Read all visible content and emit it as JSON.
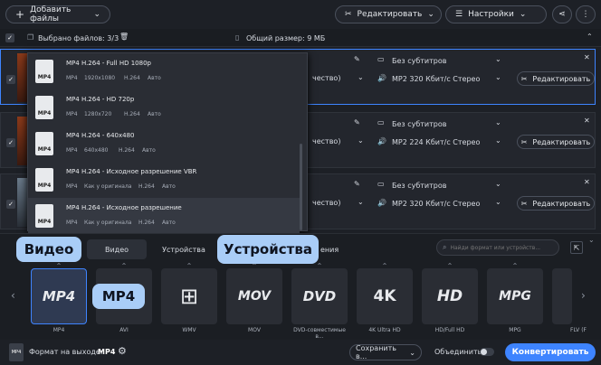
{
  "toolbar": {
    "add_files": "Добавить файлы",
    "edit": "Редактировать",
    "settings": "Настройки"
  },
  "filesbar": {
    "selected": "Выбрано файлов: 3/3",
    "total_size": "Общий размер: 9 МБ"
  },
  "rows": [
    {
      "subtitle": "Без субтитров",
      "audio": "MP2 320 Кбит/с Стерео",
      "quality_tail": "чество)",
      "edit": "Редактировать"
    },
    {
      "subtitle": "Без субтитров",
      "audio": "MP2 224 Кбит/с Стерео",
      "quality_tail": "чество)",
      "edit": "Редактировать"
    },
    {
      "subtitle": "Без субтитров",
      "audio": "MP2 320 Кбит/с Стерео",
      "quality_tail": "чество)",
      "edit": "Редактировать"
    }
  ],
  "dropdown": {
    "items": [
      {
        "title": "MP4 H.264 - Full HD 1080p",
        "specs": [
          "MP4",
          "1920x1080",
          "H.264",
          "Авто"
        ],
        "icon": "MP4"
      },
      {
        "title": "MP4 H.264 - HD 720p",
        "specs": [
          "MP4",
          "1280x720",
          "H.264",
          "Авто"
        ],
        "icon": "MP4"
      },
      {
        "title": "MP4 H.264 - 640x480",
        "specs": [
          "MP4",
          "640x480",
          "H.264",
          "Авто"
        ],
        "icon": "MP4"
      },
      {
        "title": "MP4 H.264 - Исходное разрешение VBR",
        "specs": [
          "MP4",
          "Как у оригинала",
          "H.264",
          "Авто"
        ],
        "icon": "MP4"
      },
      {
        "title": "MP4 H.264 - Исходное разрешение",
        "specs": [
          "MP4",
          "Как у оригинала",
          "H.264",
          "Авто"
        ],
        "icon": "MP4"
      }
    ]
  },
  "tabs": {
    "video": "Видео",
    "devices": "Устройства",
    "partial": "ения"
  },
  "search_placeholder": "Найди формат или устройств...",
  "callouts": {
    "video": "Видео",
    "devices": "Устройства",
    "mp4": "MP4"
  },
  "formats": [
    {
      "icon": "MP4",
      "label": "MP4"
    },
    {
      "icon": "",
      "label": "AVI"
    },
    {
      "icon": "WIN",
      "label": "WMV"
    },
    {
      "icon": "MOV",
      "label": "MOV"
    },
    {
      "icon": "DVD",
      "label": "DVD-совместимые в..."
    },
    {
      "icon": "4K",
      "label": "4K Ultra HD"
    },
    {
      "icon": "HD",
      "label": "HD/Full HD"
    },
    {
      "icon": "MPG",
      "label": "MPG"
    },
    {
      "icon": "",
      "label": "FLV (F"
    }
  ],
  "bottom": {
    "output_label": "Формат на выходе:",
    "output_value": "MP4",
    "save_to": "Сохранить в...",
    "merge": "Объединить:",
    "convert": "Конвертировать"
  },
  "colors": {
    "accent": "#3e84ff",
    "callout": "#a9cdf7"
  }
}
